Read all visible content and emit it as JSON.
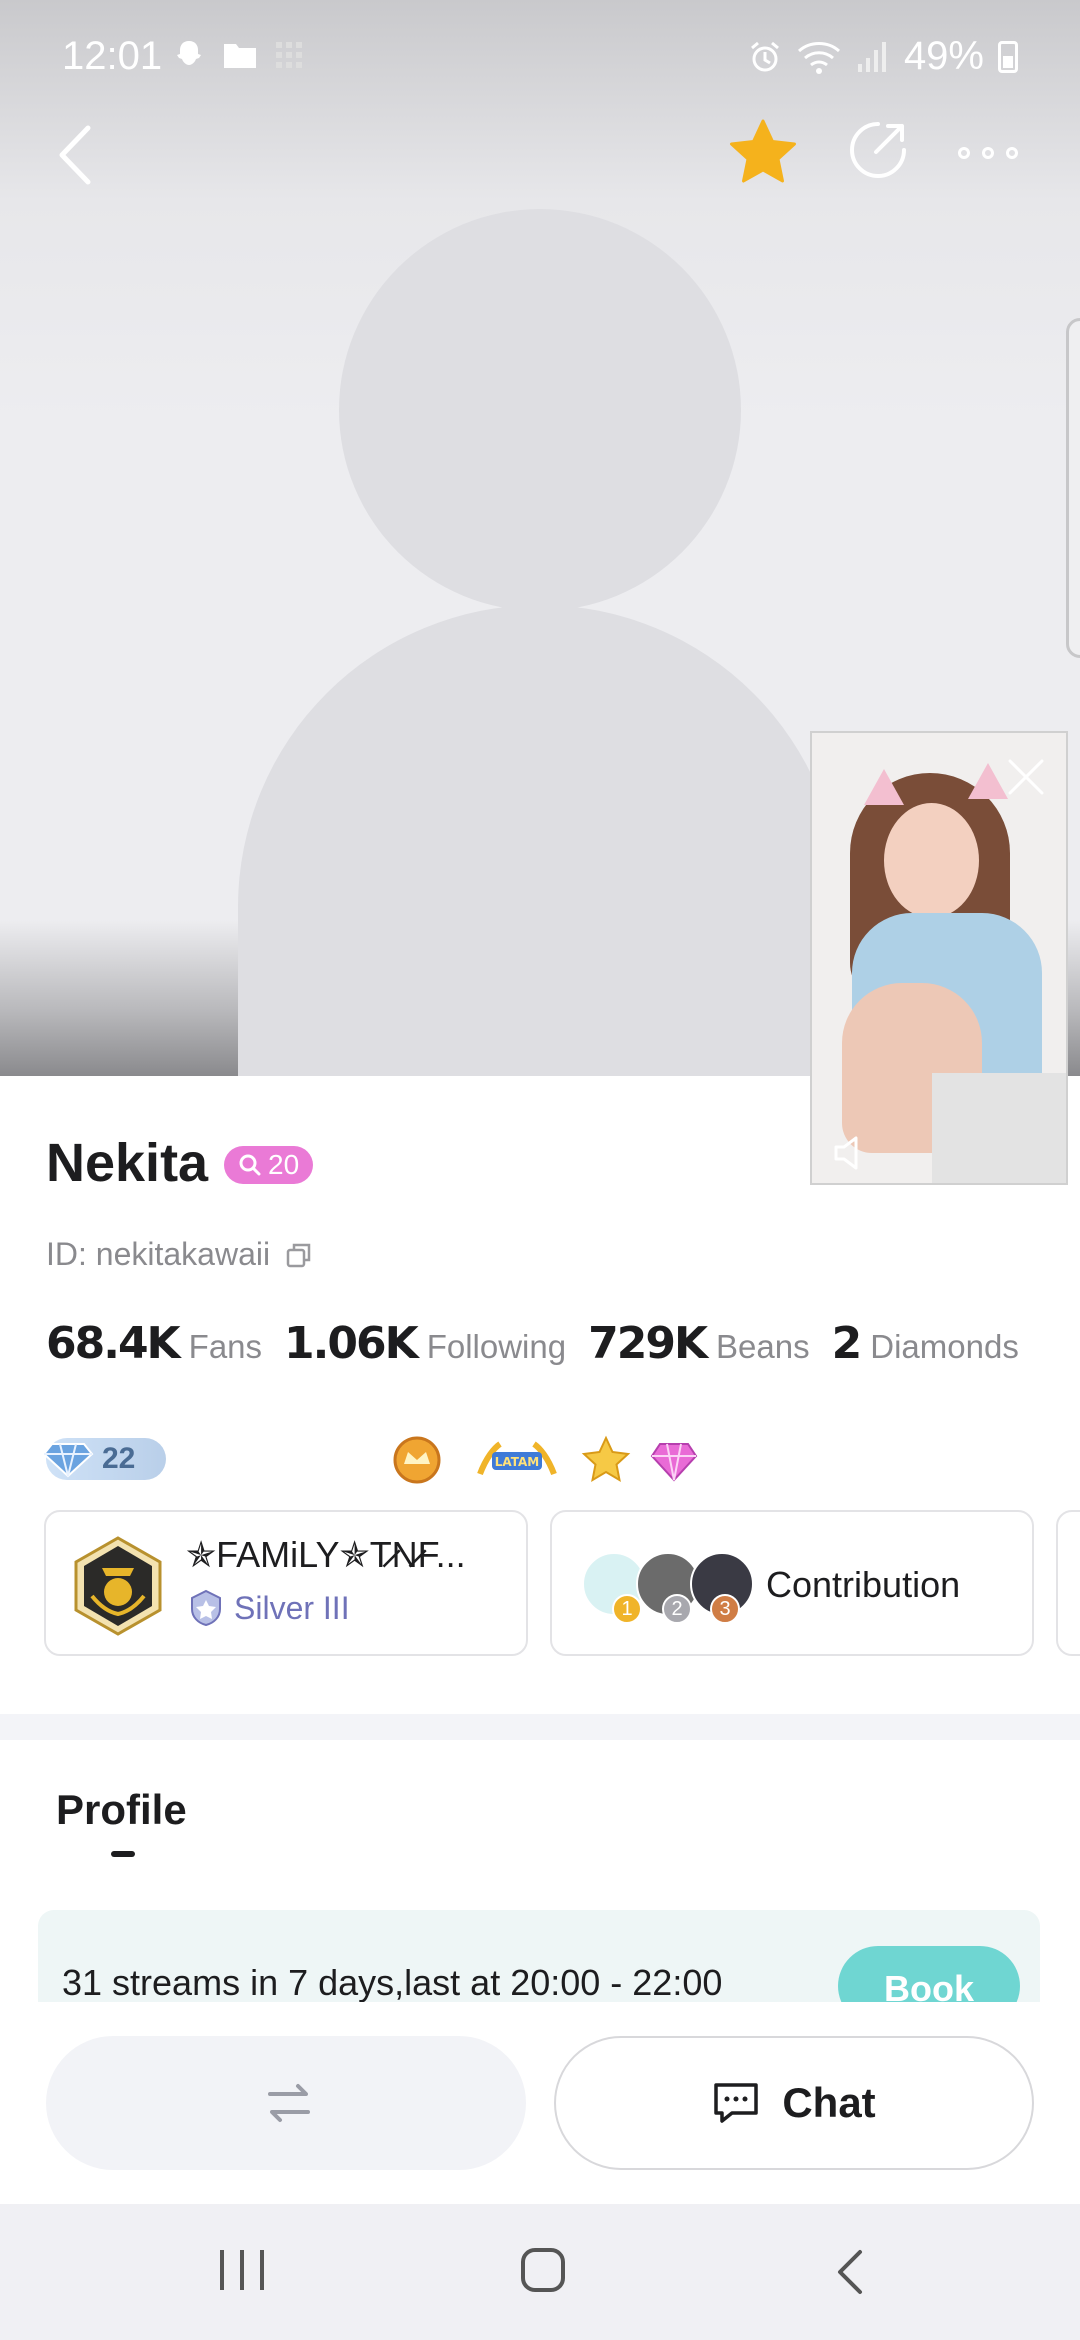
{
  "status_bar": {
    "time": "12:01",
    "battery": "49%",
    "left_icons": [
      "snapchat-icon",
      "folder-icon",
      "grid-icon"
    ],
    "right_icons": [
      "alarm-icon",
      "wifi-icon",
      "signal-icon",
      "battery-icon"
    ]
  },
  "nav": {
    "back_icon": "chevron-left-icon",
    "favorite_icon": "star-icon",
    "favorite_color": "#F5B21C",
    "share_icon": "share-icon",
    "more_icon": "more-dots-icon"
  },
  "profile": {
    "name": "Nekita",
    "level": "20",
    "level_color": "#EA7AD6",
    "id": "ID: nekitakawaii"
  },
  "stats": [
    {
      "value": "68.4K",
      "label": "Fans"
    },
    {
      "value": "1.06K",
      "label": "Following"
    },
    {
      "value": "729K",
      "label": "Beans"
    },
    {
      "value": "2",
      "label": "Diamonds"
    }
  ],
  "badges": {
    "diamond_count": "22",
    "medals": [
      "crown-medal-icon",
      "latam-medal-icon",
      "star-medal-icon",
      "gem-medal-icon"
    ]
  },
  "family_card": {
    "name": "✯FAMiLY✯T̷N̷F...",
    "rank": "Silver III"
  },
  "contribution_card": {
    "label": "Contribution",
    "ranks": [
      "1",
      "2",
      "3"
    ]
  },
  "tabs": {
    "profile": "Profile"
  },
  "schedule": {
    "text": "31 streams in 7 days,last at 20:00 - 22:00",
    "book_label": "Book",
    "book_color": "#6FD6D2"
  },
  "actions": {
    "switch_icon": "swap-arrows-icon",
    "chat_label": "Chat",
    "chat_icon": "chat-bubble-icon"
  },
  "system_nav": [
    "recent-apps-icon",
    "home-icon",
    "back-icon"
  ]
}
